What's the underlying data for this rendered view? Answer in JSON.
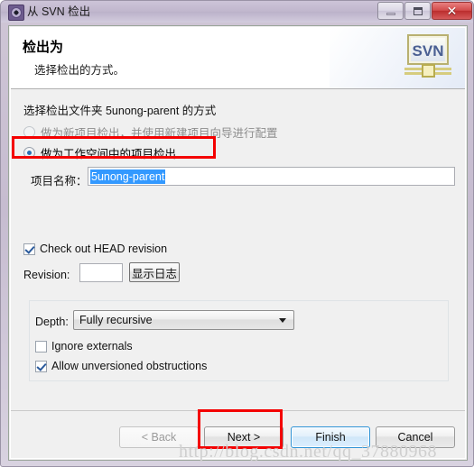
{
  "window": {
    "title": "从 SVN 检出",
    "icon": "svn-repository-icon",
    "controls": {
      "minimize": "–",
      "maximize": "□",
      "close": "✕"
    }
  },
  "header": {
    "title": "检出为",
    "subtitle": "选择检出的方式。",
    "logo_text": "SVN",
    "logo_name": "svn-banner-logo"
  },
  "content": {
    "description": "选择检出文件夹 5unong-parent 的方式",
    "radios": [
      {
        "label": "做为新项目检出，并使用新建项目向导进行配置",
        "selected": false,
        "enabled": false
      },
      {
        "label": "做为工作空间中的项目检出",
        "selected": true,
        "enabled": true
      }
    ],
    "project_name": {
      "label": "项目名称：",
      "value": "5unong-parent",
      "placeholder": "",
      "selected": true
    },
    "head_revision": {
      "label": "Check out HEAD revision",
      "checked": true
    },
    "revision": {
      "label": "Revision:",
      "value": "",
      "placeholder": "",
      "show_log_button": "显示日志"
    },
    "depth_group": {
      "depth_label": "Depth:",
      "depth_value": "Fully recursive",
      "depth_options": [
        "Fully recursive"
      ],
      "checkboxes": [
        {
          "label": "Ignore externals",
          "checked": false
        },
        {
          "label": "Allow unversioned obstructions",
          "checked": true
        }
      ]
    }
  },
  "buttons": {
    "back": "< Back",
    "next": "Next >",
    "finish": "Finish",
    "cancel": "Cancel"
  },
  "annotations": {
    "highlight_color": "#f40000",
    "watermark": "http://blog.csdn.net/qq_37880968"
  }
}
